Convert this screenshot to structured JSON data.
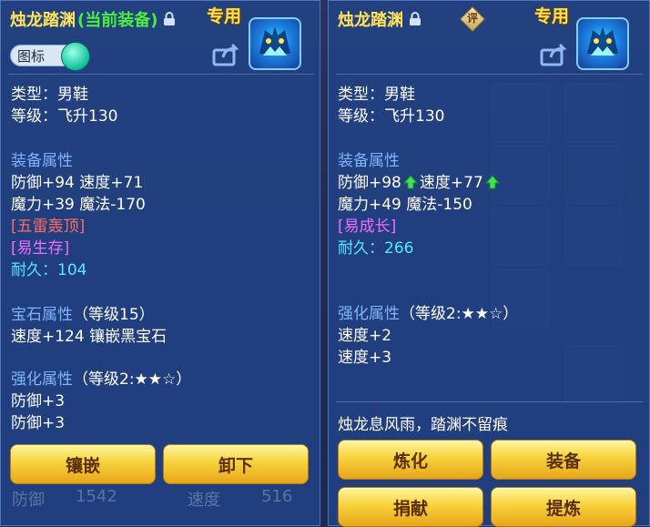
{
  "left": {
    "title": "烛龙踏渊",
    "title_suffix": "(当前装备)",
    "exclusive": "专用",
    "toggle_label": "图标",
    "type_line": "类型：男鞋",
    "level_line": "等级：飞升130",
    "equip_attr_header": "装备属性",
    "attr_line1": "防御+94 速度+71",
    "attr_line2": "魔力+39 魔法-170",
    "skill1": "[五雷轰顶]",
    "skill2": "[易生存]",
    "durability_label": "耐久：",
    "durability_value": "104",
    "gem_header": "宝石属性",
    "gem_level": "（等级15）",
    "gem_line": "速度+124 镶嵌黑宝石",
    "enhance_header": "强化属性",
    "enhance_level": "（等级2:★★☆）",
    "enhance_line1": "防御+3",
    "enhance_line2": "防御+3",
    "btn_inlay": "镶嵌",
    "btn_unequip": "卸下"
  },
  "right": {
    "title": "烛龙踏渊",
    "eval": "评",
    "exclusive": "专用",
    "type_line": "类型：男鞋",
    "level_line": "等级：飞升130",
    "equip_attr_header": "装备属性",
    "attr_def": "防御+98",
    "attr_spd": "速度+77",
    "attr_line2": "魔力+49 魔法-150",
    "skill1": "[易成长]",
    "durability_label": "耐久：",
    "durability_value": "266",
    "enhance_header": "强化属性",
    "enhance_level": "（等级2:★★☆）",
    "enhance_line1": "速度+2",
    "enhance_line2": "速度+3",
    "flavor": "烛龙息风雨，踏渊不留痕",
    "btn_refine": "炼化",
    "btn_equip": "装备",
    "btn_donate": "捐献",
    "btn_extract": "提炼"
  },
  "background": {
    "stat_def_label": "防御",
    "stat_def_value": "1542",
    "stat_spd_label": "速度",
    "stat_spd_value": "516"
  }
}
